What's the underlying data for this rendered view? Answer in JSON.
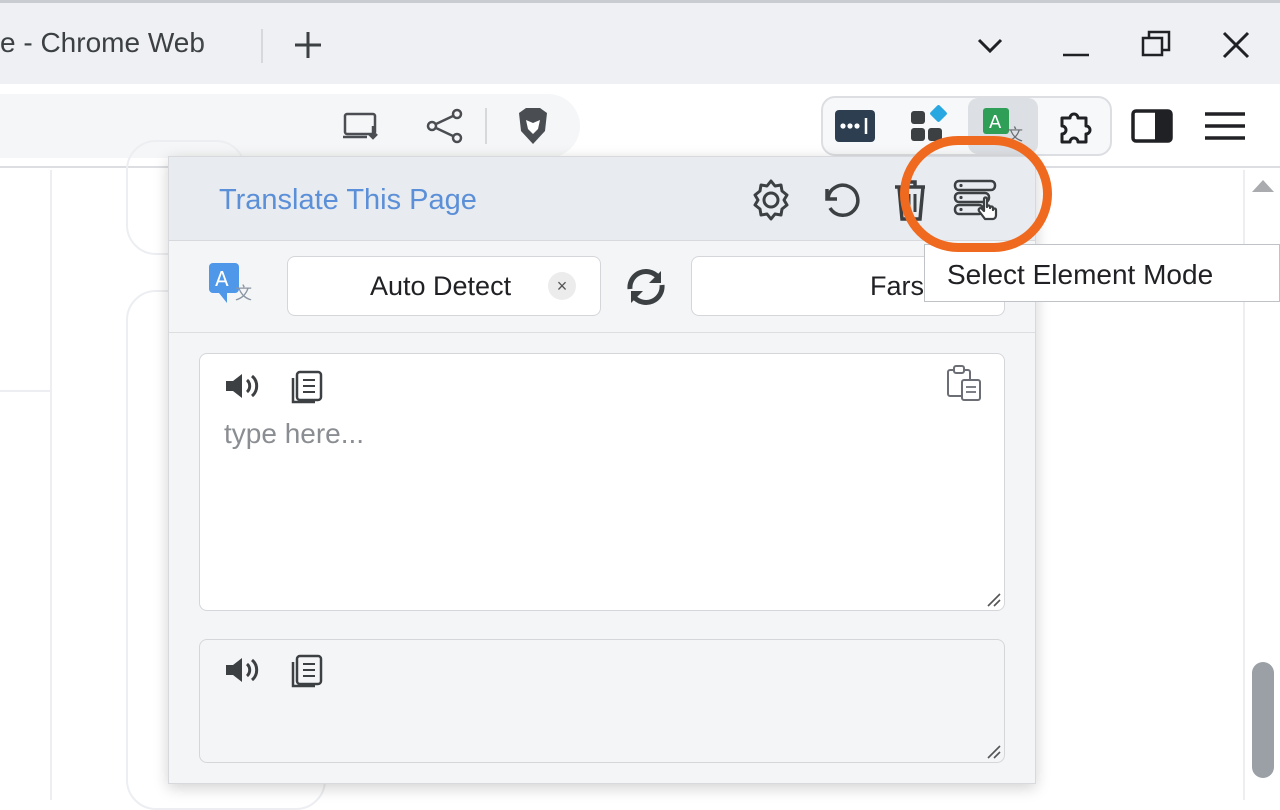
{
  "browser": {
    "tab_title": "e - Chrome Web",
    "newtab_symbol": "+",
    "icons": [
      "chevron-down-icon",
      "minimize-icon",
      "restore-icon",
      "close-icon",
      "install-app-icon",
      "share-icon",
      "brave-shields-icon",
      "password-manager-icon",
      "extension-grid-icon",
      "translate-extension-icon",
      "puzzle-icon",
      "sidebar-icon",
      "menu-icon"
    ]
  },
  "popup": {
    "title": "Translate This Page",
    "source_lang": "Auto Detect",
    "clear_symbol": "×",
    "target_lang": "Farsi",
    "input_placeholder": "type here...",
    "accent_color": "#5b8fd8"
  },
  "tooltip": {
    "text": "Select Element Mode"
  },
  "highlight_color": "#ef6a1f"
}
